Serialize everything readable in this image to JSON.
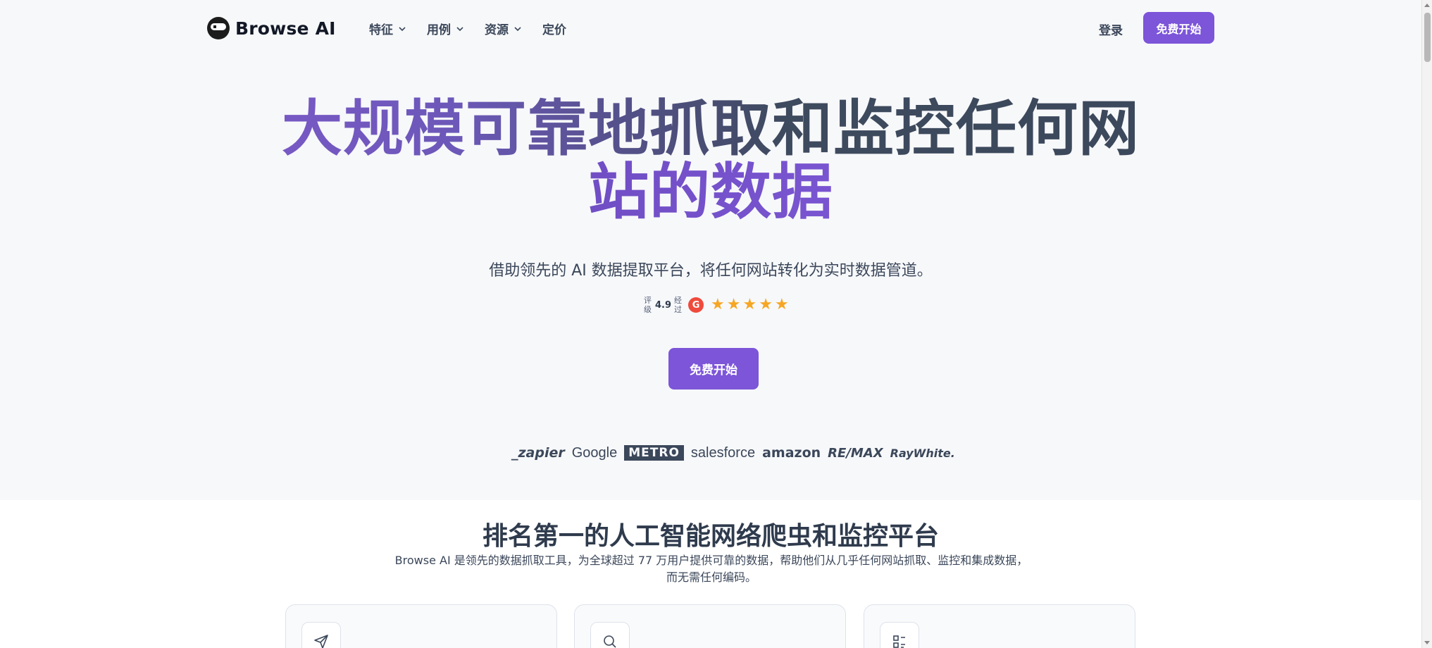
{
  "brand": {
    "name": "Browse AI"
  },
  "nav": {
    "items": [
      {
        "label": "特征",
        "has_dropdown": true
      },
      {
        "label": "用例",
        "has_dropdown": true
      },
      {
        "label": "资源",
        "has_dropdown": true
      },
      {
        "label": "定价",
        "has_dropdown": false
      }
    ],
    "login_label": "登录",
    "cta_label": "免费开始"
  },
  "hero": {
    "title_line1": "大规模可靠地抓取和监控任何网",
    "title_line2": "站的数据",
    "subtitle": "借助领先的 AI 数据提取平台，将任何网站转化为实时数据管道。",
    "rating": {
      "prefix": "评级",
      "score": "4.9",
      "suffix": "经过",
      "platform_badge": "G",
      "stars": 5
    },
    "cta_label": "免费开始"
  },
  "customer_logos": [
    "_zapier",
    "Google",
    "METRO",
    "salesforce",
    "amazon",
    "RE/MAX",
    "RayWhite."
  ],
  "section2": {
    "title": "排名第一的人工智能网络爬虫和监控平台",
    "description_line1": "Browse AI 是领先的数据抓取工具，为全球超过 77 万用户提供可靠的数据，帮助他们从几乎任何网站抓取、监控和集成数据，",
    "description_line2": "而无需任何编码。",
    "cards": [
      {
        "icon": "send-icon"
      },
      {
        "icon": "search-icon"
      },
      {
        "icon": "scan-icon"
      }
    ]
  },
  "colors": {
    "accent": "#7c55d9",
    "background": "#f7f8fa",
    "text": "#2f3b4d",
    "star": "#f6a623",
    "g2": "#ef4b3c"
  }
}
